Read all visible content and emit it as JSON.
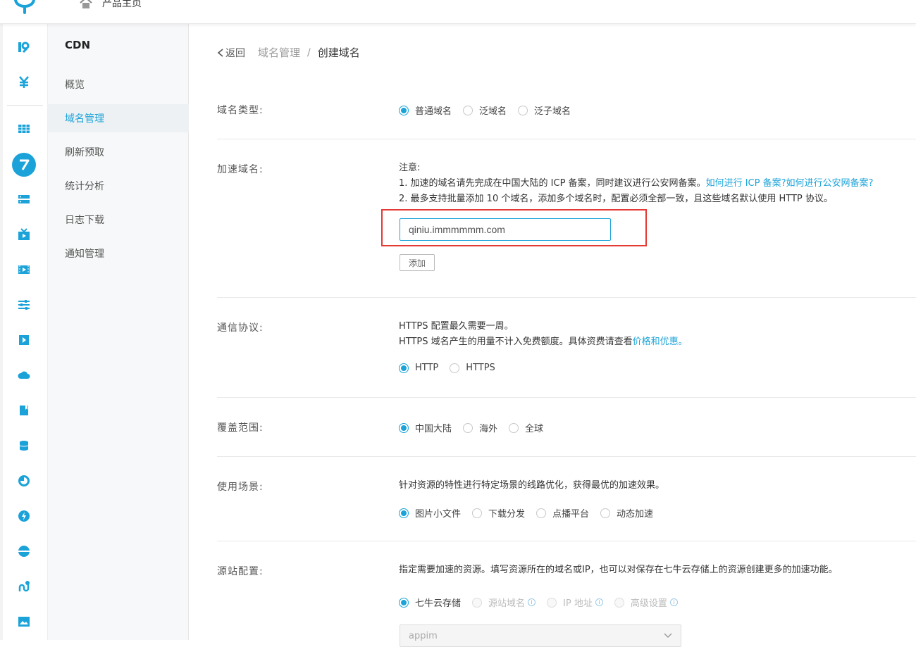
{
  "header": {
    "home_label": "产品主页"
  },
  "rail": {
    "icons": [
      "kodo-icon",
      "billing-icon",
      "grid-icon",
      "cdn-icon",
      "server-icon",
      "tv-icon",
      "video-icon",
      "sliders-icon",
      "play-icon",
      "cloud-icon",
      "book-icon",
      "database-icon",
      "pie-icon",
      "lightning-icon",
      "globe-icon",
      "pipeline-icon",
      "image-icon"
    ]
  },
  "sidebar": {
    "title": "CDN",
    "items": [
      {
        "label": "概览"
      },
      {
        "label": "域名管理"
      },
      {
        "label": "刷新预取"
      },
      {
        "label": "统计分析"
      },
      {
        "label": "日志下载"
      },
      {
        "label": "通知管理"
      }
    ]
  },
  "breadcrumb": {
    "back": "返回",
    "parent": "域名管理",
    "sep": "/",
    "current": "创建域名"
  },
  "domain_type": {
    "label": "域名类型:",
    "options": [
      "普通域名",
      "泛域名",
      "泛子域名"
    ],
    "selected": "普通域名"
  },
  "accel_domain": {
    "label": "加速域名:",
    "note_title": "注意:",
    "note1": "1. 加速的域名请先完成在中国大陆的 ICP 备案，同时建议进行公安网备案。",
    "note1_link1": "如何进行 ICP 备案?",
    "note1_link2": "如何进行公安网备案?",
    "note2": "2. 最多支持批量添加 10 个域名，添加多个域名时，配置必须全部一致，且这些域名默认使用 HTTP 协议。",
    "input_value": "qiniu.immmmmm.com",
    "add_button": "添加"
  },
  "protocol": {
    "label": "通信协议:",
    "line1": "HTTPS 配置最久需要一周。",
    "line2": "HTTPS 域名产生的用量不计入免费额度。具体资费请查看",
    "line2_link": "价格和优惠。",
    "options": [
      "HTTP",
      "HTTPS"
    ],
    "selected": "HTTP"
  },
  "coverage": {
    "label": "覆盖范围:",
    "options": [
      "中国大陆",
      "海外",
      "全球"
    ],
    "selected": "中国大陆"
  },
  "scenario": {
    "label": "使用场景:",
    "desc": "针对资源的特性进行特定场景的线路优化，获得最优的加速效果。",
    "options": [
      "图片小文件",
      "下载分发",
      "点播平台",
      "动态加速"
    ],
    "selected": "图片小文件"
  },
  "origin": {
    "label": "源站配置:",
    "desc": "指定需要加速的资源。填写资源所在的域名或IP，也可以对保存在七牛云存储上的资源创建更多的加速功能。",
    "options": [
      "七牛云存储",
      "源站域名",
      "IP 地址",
      "高级设置"
    ],
    "selected": "七牛云存储",
    "bucket_value": "appim"
  },
  "colors": {
    "accent": "#1ba3d9",
    "highlight": "#e53935"
  }
}
